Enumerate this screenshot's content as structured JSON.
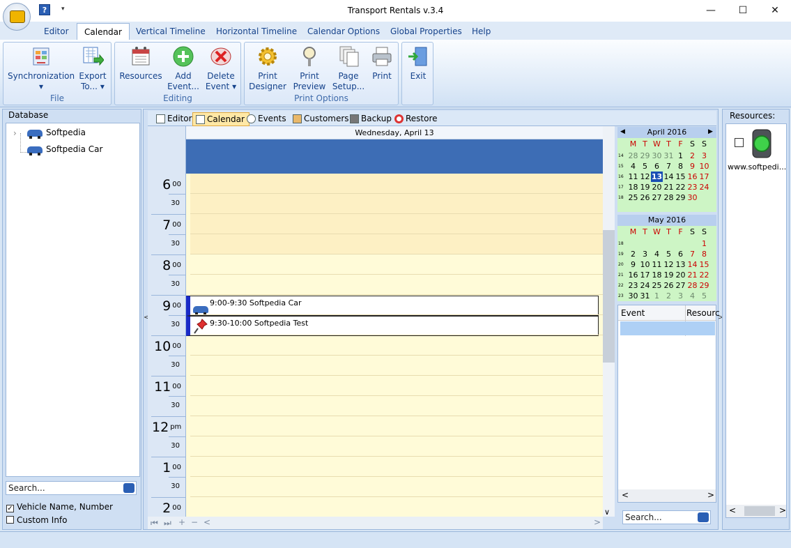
{
  "window": {
    "title": "Transport Rentals v.3.4",
    "minimize": "—",
    "maximize": "☐",
    "close": "✕",
    "qat_help": "?",
    "qat_dropdown": "▾"
  },
  "tabs": [
    "Editor",
    "Calendar",
    "Vertical Timeline",
    "Horizontal Timeline",
    "Calendar Options",
    "Global Properties",
    "Help"
  ],
  "ribbon": {
    "file": {
      "label": "File",
      "sync": "Synchronization",
      "export1": "Export",
      "export2": "To...",
      "arrow": "▾"
    },
    "editing": {
      "label": "Editing",
      "resources": "Resources",
      "add1": "Add",
      "add2": "Event...",
      "del1": "Delete",
      "del2": "Event",
      "arrow": "▾"
    },
    "print": {
      "label": "Print Options",
      "designer1": "Print",
      "designer2": "Designer",
      "preview1": "Print",
      "preview2": "Preview",
      "setup1": "Page",
      "setup2": "Setup...",
      "print": "Print"
    },
    "exit": {
      "label": "Exit"
    }
  },
  "database": {
    "title": "Database",
    "items": [
      "Softpedia",
      "Softpedia Car"
    ],
    "search_placeholder": "Search...",
    "options": [
      {
        "label": "Vehicle Name, Number",
        "checked": "✓"
      },
      {
        "label": "Custom Info",
        "checked": ""
      }
    ]
  },
  "views": [
    "Editor",
    "Calendar",
    "Events",
    "Customers",
    "Backup",
    "Restore"
  ],
  "calendar": {
    "day_header": "Wednesday, April 13",
    "hours": [
      {
        "h": "6",
        "m": "00"
      },
      {
        "h": "7",
        "m": "00"
      },
      {
        "h": "8",
        "m": "00"
      },
      {
        "h": "9",
        "m": "00"
      },
      {
        "h": "10",
        "m": "00"
      },
      {
        "h": "11",
        "m": "00"
      },
      {
        "h": "12",
        "m": "pm"
      },
      {
        "h": "1",
        "m": "00"
      },
      {
        "h": "2",
        "m": "00"
      }
    ],
    "half": "30",
    "events": [
      "9:00-9:30 Softpedia Car",
      "9:30-10:00 Softpedia Test"
    ]
  },
  "minical": {
    "weekdays": [
      "M",
      "T",
      "W",
      "T",
      "F",
      "S",
      "S"
    ],
    "april": {
      "title": "April 2016",
      "weeks": [
        {
          "w": "14",
          "d": [
            "28",
            "29",
            "30",
            "31",
            "1",
            "2",
            "3"
          ]
        },
        {
          "w": "15",
          "d": [
            "4",
            "5",
            "6",
            "7",
            "8",
            "9",
            "10"
          ]
        },
        {
          "w": "16",
          "d": [
            "11",
            "12",
            "13",
            "14",
            "15",
            "16",
            "17"
          ]
        },
        {
          "w": "17",
          "d": [
            "18",
            "19",
            "20",
            "21",
            "22",
            "23",
            "24"
          ]
        },
        {
          "w": "18",
          "d": [
            "25",
            "26",
            "27",
            "28",
            "29",
            "30",
            ""
          ]
        }
      ]
    },
    "may": {
      "title": "May 2016",
      "weeks": [
        {
          "w": "18",
          "d": [
            "",
            "",
            "",
            "",
            "",
            "",
            "1"
          ]
        },
        {
          "w": "19",
          "d": [
            "2",
            "3",
            "4",
            "5",
            "6",
            "7",
            "8"
          ]
        },
        {
          "w": "20",
          "d": [
            "9",
            "10",
            "11",
            "12",
            "13",
            "14",
            "15"
          ]
        },
        {
          "w": "21",
          "d": [
            "16",
            "17",
            "18",
            "19",
            "20",
            "21",
            "22"
          ]
        },
        {
          "w": "22",
          "d": [
            "23",
            "24",
            "25",
            "26",
            "27",
            "28",
            "29"
          ]
        },
        {
          "w": "23",
          "d": [
            "30",
            "31",
            "1",
            "2",
            "3",
            "4",
            "5"
          ]
        }
      ]
    }
  },
  "event_grid": {
    "columns": [
      "Event",
      "Resourc"
    ],
    "search_placeholder": "Search..."
  },
  "resources": {
    "title": "Resources:",
    "item": "www.softpedi..."
  },
  "nav": {
    "left": "◀",
    "right": "▶",
    "up": "▲",
    "down": "▼",
    "lt": "<",
    "gt": ">",
    "first": "⏮",
    "last": "⏭",
    "plus": "+",
    "minus": "−",
    "vdown": "∨"
  },
  "colors": {
    "accent": "#3d6db5",
    "selected_day": "#1a4fb4",
    "weekend": "#cc0000"
  }
}
